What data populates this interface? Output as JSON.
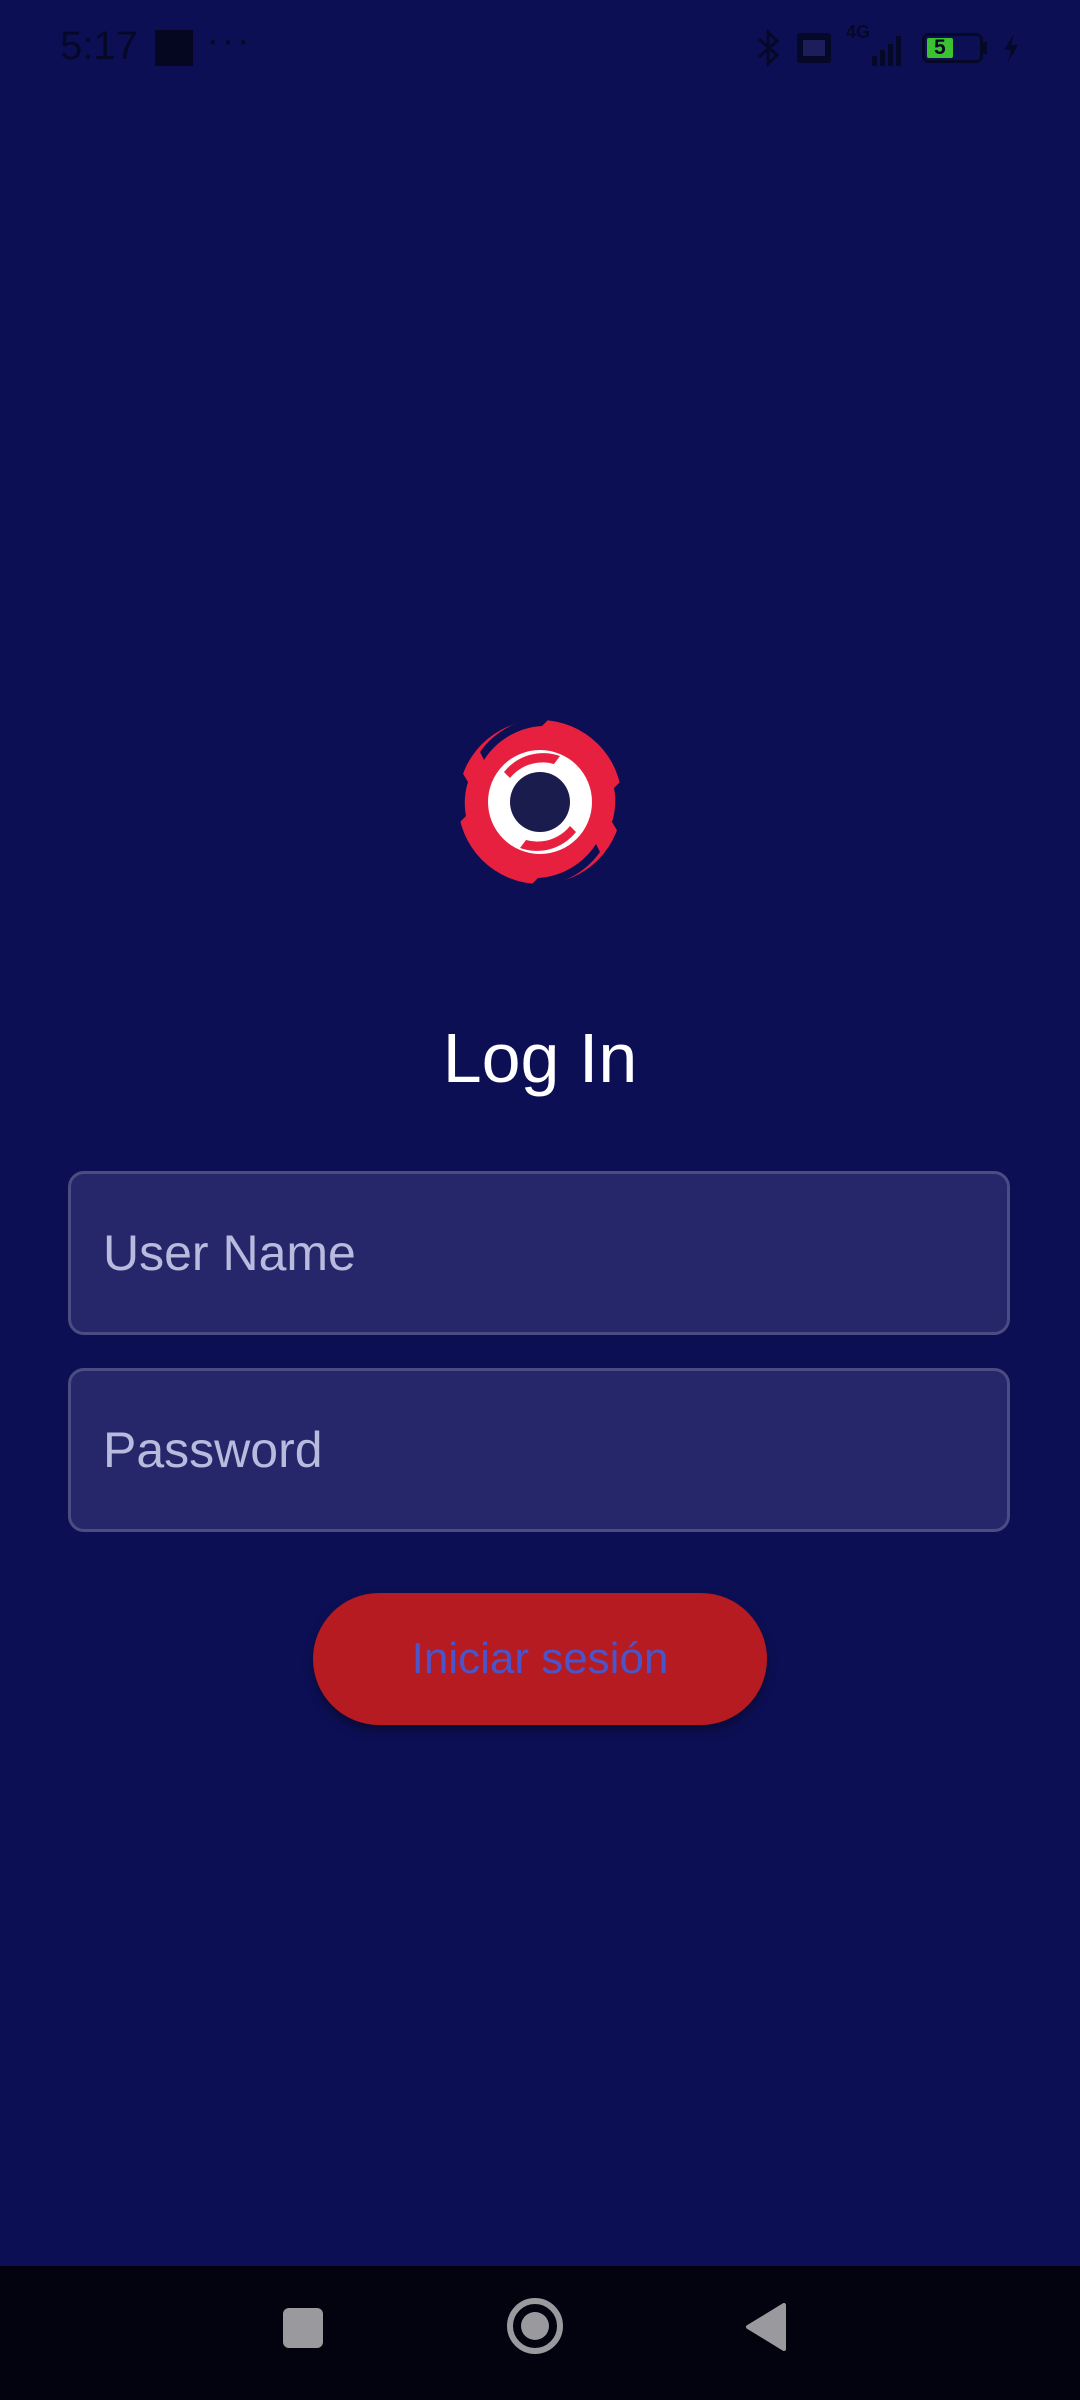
{
  "status_bar": {
    "time": "5:17",
    "extra_indicator": "···",
    "battery_level": "5",
    "network": "4G",
    "icons": [
      "bluetooth-icon",
      "vpn-icon",
      "signal-icon",
      "battery-icon",
      "charging-icon"
    ]
  },
  "app": {
    "logo_icon": "swirl-logo-icon",
    "title": "Log In",
    "username": {
      "value": "",
      "placeholder": "User Name"
    },
    "password": {
      "value": "",
      "placeholder": "Password"
    },
    "login_button_label": "Iniciar sesión"
  },
  "nav_bar": {
    "icons": [
      "recents-icon",
      "home-icon",
      "back-icon"
    ]
  },
  "colors": {
    "background": "#0d0f55",
    "field_background": "#25276a",
    "button": "#b51b20",
    "button_text": "#4b55c9",
    "logo_red": "#e8203f"
  }
}
